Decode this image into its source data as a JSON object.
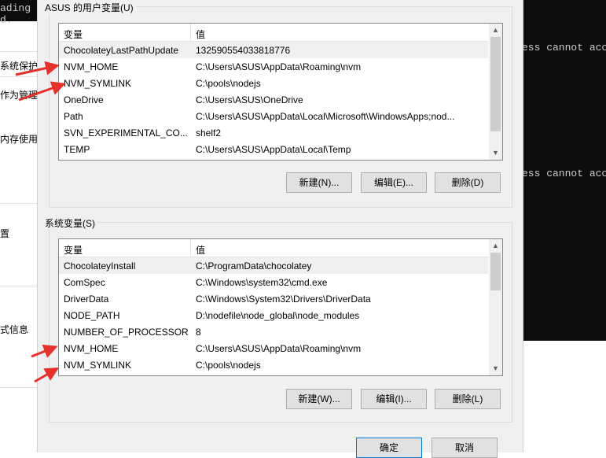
{
  "left_window": {
    "terminal_lines": [
      "ading r",
      "d."
    ],
    "items": [
      "系统保护",
      "作为管理",
      "内存使用，",
      "置",
      "式信息"
    ]
  },
  "right_terminal": {
    "lines": [
      "ess cannot acc",
      "ess cannot acc"
    ]
  },
  "user_vars": {
    "title": "ASUS 的用户变量(U)",
    "col_var": "变量",
    "col_val": "值",
    "rows": [
      {
        "name": "ChocolateyLastPathUpdate",
        "value": "132590554033818776"
      },
      {
        "name": "NVM_HOME",
        "value": "C:\\Users\\ASUS\\AppData\\Roaming\\nvm"
      },
      {
        "name": "NVM_SYMLINK",
        "value": "C:\\pools\\nodejs"
      },
      {
        "name": "OneDrive",
        "value": "C:\\Users\\ASUS\\OneDrive"
      },
      {
        "name": "Path",
        "value": "C:\\Users\\ASUS\\AppData\\Local\\Microsoft\\WindowsApps;nod..."
      },
      {
        "name": "SVN_EXPERIMENTAL_CO...",
        "value": "shelf2"
      },
      {
        "name": "TEMP",
        "value": "C:\\Users\\ASUS\\AppData\\Local\\Temp"
      }
    ],
    "buttons": {
      "new": "新建(N)...",
      "edit": "编辑(E)...",
      "delete": "删除(D)"
    }
  },
  "system_vars": {
    "title": "系统变量(S)",
    "col_var": "变量",
    "col_val": "值",
    "rows": [
      {
        "name": "ChocolateyInstall",
        "value": "C:\\ProgramData\\chocolatey"
      },
      {
        "name": "ComSpec",
        "value": "C:\\Windows\\system32\\cmd.exe"
      },
      {
        "name": "DriverData",
        "value": "C:\\Windows\\System32\\Drivers\\DriverData"
      },
      {
        "name": "NODE_PATH",
        "value": "D:\\nodefile\\node_global\\node_modules"
      },
      {
        "name": "NUMBER_OF_PROCESSORS",
        "value": "8"
      },
      {
        "name": "NVM_HOME",
        "value": "C:\\Users\\ASUS\\AppData\\Roaming\\nvm"
      },
      {
        "name": "NVM_SYMLINK",
        "value": "C:\\pools\\nodejs"
      }
    ],
    "buttons": {
      "new": "新建(W)...",
      "edit": "编辑(I)...",
      "delete": "删除(L)"
    }
  },
  "footer": {
    "ok": "确定",
    "cancel": "取消"
  },
  "colors": {
    "annotation_arrow": "#e5312b",
    "selection": "#f0f0f0"
  }
}
